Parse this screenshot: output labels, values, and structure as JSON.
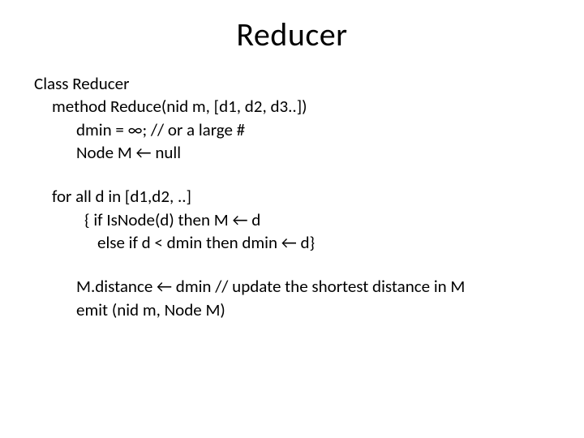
{
  "title": "Reducer",
  "lines": {
    "l1": "Class Reducer",
    "l2": "method Reduce(nid m, [d1, d2, d3..])",
    "l3": "dmin = ∞; // or a large #",
    "l4": "Node M ← null",
    "l5": "for all d in [d1,d2, ..]",
    "l6": "{ if IsNode(d) then M ← d",
    "l7": "else if d < dmin then dmin ← d}",
    "l8": "M.distance ← dmin  // update the shortest distance in M",
    "l9": "emit (nid m, Node M)"
  }
}
